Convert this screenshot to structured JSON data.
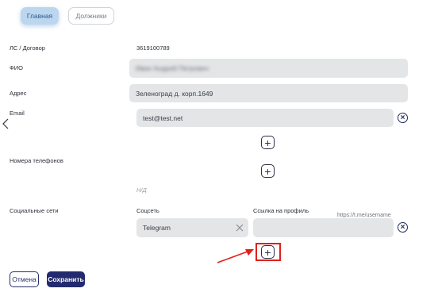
{
  "tabs": {
    "main": "Главная",
    "positions": "Должники"
  },
  "account": {
    "label": "ЛС / Договор",
    "value": "3619100789"
  },
  "fio": {
    "label": "ФИО",
    "value": "Ивин Андрей Петрович"
  },
  "address": {
    "label": "Адрес",
    "value": "Зеленоград д. корп.1649"
  },
  "email": {
    "label": "Email",
    "value": "test@test.net"
  },
  "phones": {
    "label": "Номера телефонов",
    "empty": "Н/Д"
  },
  "social": {
    "label": "Социальные сети",
    "col_network": "Соцсеть",
    "col_link": "Ссылка на профиль",
    "link_placeholder": "https://t.me/username",
    "network_value": "Telegram",
    "link_value": ""
  },
  "buttons": {
    "cancel": "Отмена",
    "save": "Сохранить"
  },
  "icons": {
    "back": "chevron-left-icon",
    "remove": "circle-x-icon",
    "add": "plus-icon",
    "clear": "x-icon",
    "annotation": "red-arrow"
  },
  "colors": {
    "accent": "#232b6e",
    "highlight": "#e0201c",
    "active_tab": "#bcd6ef"
  }
}
